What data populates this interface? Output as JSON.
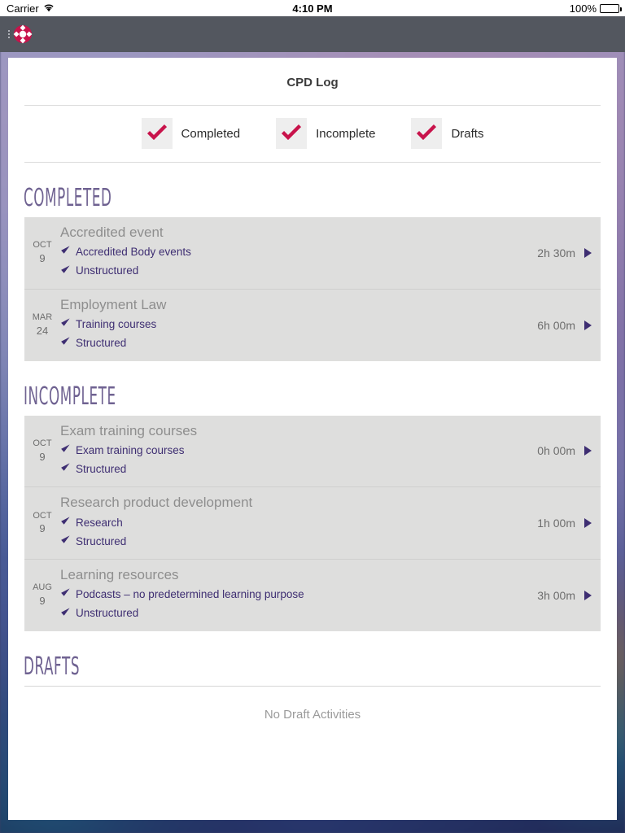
{
  "status_bar": {
    "carrier": "Carrier",
    "wifi_icon": "wifi-icon",
    "time": "4:10 PM",
    "battery_percent": "100%",
    "battery_icon": "battery-full-icon"
  },
  "nav_bar": {
    "logo_icon": "app-logo-icon",
    "background_color": "#53575f"
  },
  "header": {
    "title": "CPD Log"
  },
  "filters": [
    {
      "label": "Completed",
      "checked": true,
      "icon": "check-icon"
    },
    {
      "label": "Incomplete",
      "checked": true,
      "icon": "check-icon"
    },
    {
      "label": "Drafts",
      "checked": true,
      "icon": "check-icon"
    }
  ],
  "sections": [
    {
      "heading": "COMPLETED",
      "empty_message": "",
      "rows": [
        {
          "month": "OCT",
          "day": "9",
          "title": "Accredited event",
          "tags": [
            "Accredited Body events",
            "Unstructured"
          ],
          "duration": "2h 30m",
          "caret_icon": "chevron-right-icon"
        },
        {
          "month": "MAR",
          "day": "24",
          "title": "Employment Law",
          "tags": [
            "Training courses",
            "Structured"
          ],
          "duration": "6h 00m",
          "caret_icon": "chevron-right-icon"
        }
      ]
    },
    {
      "heading": "INCOMPLETE",
      "empty_message": "",
      "rows": [
        {
          "month": "OCT",
          "day": "9",
          "title": "Exam training courses",
          "tags": [
            "Exam training courses",
            "Structured"
          ],
          "duration": "0h 00m",
          "caret_icon": "chevron-right-icon"
        },
        {
          "month": "OCT",
          "day": "9",
          "title": "Research product development",
          "tags": [
            "Research",
            "Structured"
          ],
          "duration": "1h 00m",
          "caret_icon": "chevron-right-icon"
        },
        {
          "month": "AUG",
          "day": "9",
          "title": "Learning resources",
          "tags": [
            "Podcasts – no predetermined learning purpose",
            "Unstructured"
          ],
          "duration": "3h 00m",
          "caret_icon": "chevron-right-icon"
        }
      ]
    },
    {
      "heading": "DRAFTS",
      "empty_message": "No Draft Activities",
      "rows": []
    }
  ],
  "colors": {
    "accent_crimson": "#c8134b",
    "tag_purple": "#3e2e72",
    "heading_purple": "#6f6291",
    "row_grey": "#dededd",
    "nav_grey": "#53575f"
  }
}
